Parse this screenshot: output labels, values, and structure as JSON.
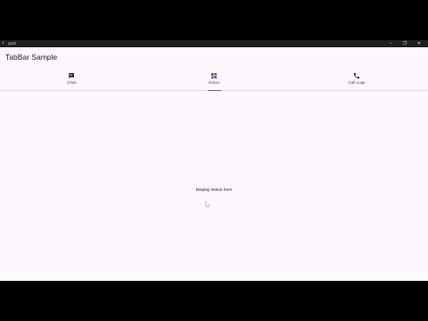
{
  "window": {
    "title": "qeat",
    "back_glyph": "‹",
    "min_glyph": "–",
    "max_glyph": "❐",
    "close_glyph": "✕"
  },
  "appbar": {
    "title": "TabBar Sample"
  },
  "tabs": [
    {
      "label": "Chat",
      "icon": "chat-icon",
      "active": false
    },
    {
      "label": "Status",
      "icon": "dashboard-icon",
      "active": true
    },
    {
      "label": "Call Logs",
      "icon": "phone-icon",
      "active": false
    }
  ],
  "content": {
    "text": "Display status here"
  },
  "colors": {
    "background": "#fdf8fd",
    "accent": "#65558f",
    "text": "#1d1b20",
    "titlebar": "#1f1f1f"
  }
}
